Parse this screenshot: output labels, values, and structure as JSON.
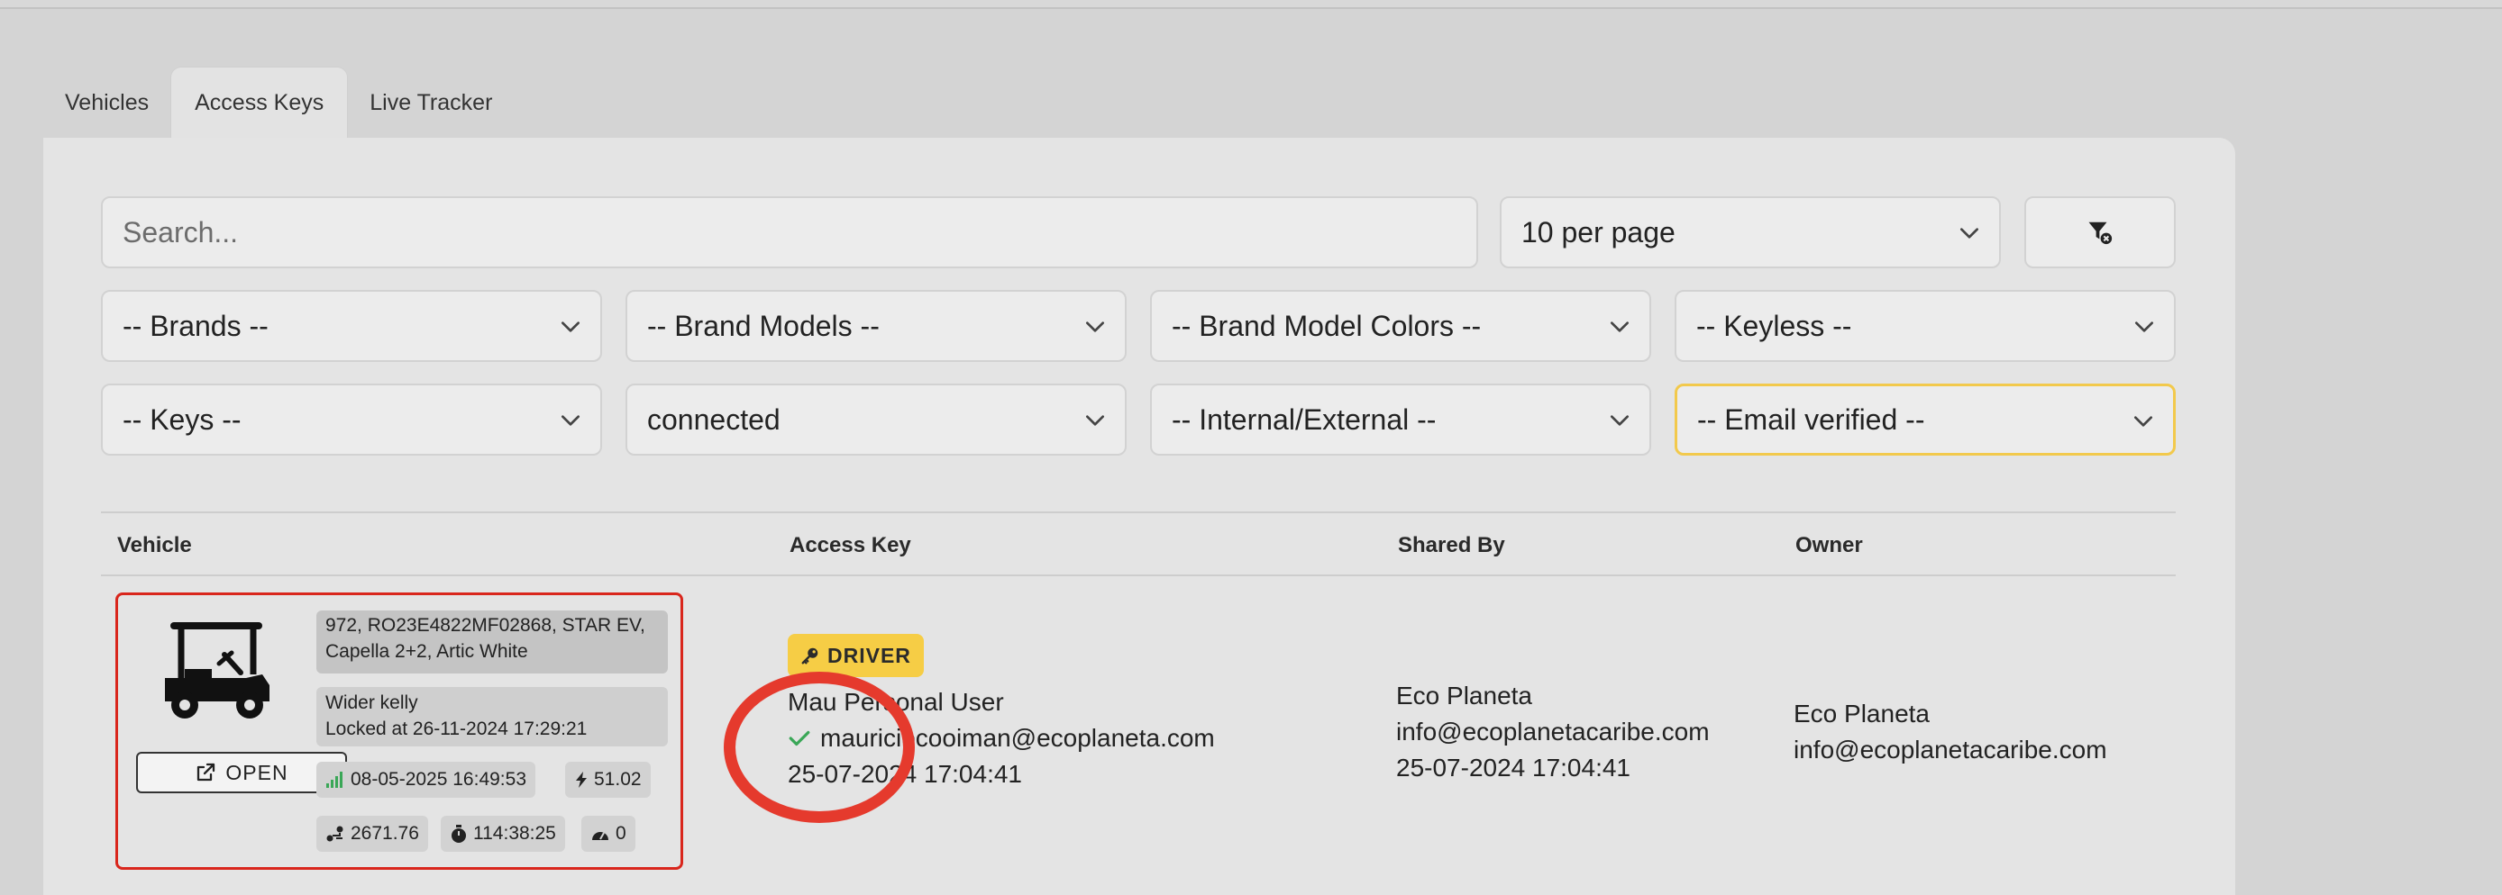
{
  "tabs": [
    {
      "label": "Vehicles"
    },
    {
      "label": "Access Keys"
    },
    {
      "label": "Live Tracker"
    }
  ],
  "search": {
    "placeholder": "Search..."
  },
  "per_page": {
    "value": "10 per page"
  },
  "filters": {
    "brands": "-- Brands --",
    "brand_models": "-- Brand Models --",
    "brand_model_colors": "-- Brand Model Colors --",
    "keyless": "-- Keyless --",
    "keys": "-- Keys --",
    "connection": "connected",
    "internal_external": "-- Internal/External --",
    "email_verified": "-- Email verified --"
  },
  "table": {
    "headers": {
      "vehicle": "Vehicle",
      "access_key": "Access Key",
      "shared_by": "Shared By",
      "owner": "Owner"
    },
    "row": {
      "vehicle": {
        "details": "972, RO23E4822MF02868, STAR EV, Capella 2+2, Artic White",
        "driver_name": "Wider kelly",
        "lock_status": "Locked at 26-11-2024 17:29:21",
        "open_label": "OPEN",
        "last_signal": "08-05-2025 16:49:53",
        "battery": "51.02",
        "odometer": "2671.76",
        "duration": "114:38:25",
        "speed": "0",
        "icon": "golf-cart-icon"
      },
      "access_key": {
        "role": "DRIVER",
        "user_name": "Mau Personal User",
        "email": "mauriciocooiman@ecoplaneta.com",
        "date": "25-07-2024 17:04:41"
      },
      "shared_by": {
        "name": "Eco Planeta",
        "email": "info@ecoplanetacaribe.com",
        "date": "25-07-2024 17:04:41"
      },
      "owner": {
        "name": "Eco Planeta",
        "email": "info@ecoplanetacaribe.com"
      }
    }
  },
  "colors": {
    "accent_yellow": "#f6cd45",
    "highlight_red": "#d9261c",
    "verified_green": "#3aa757"
  }
}
